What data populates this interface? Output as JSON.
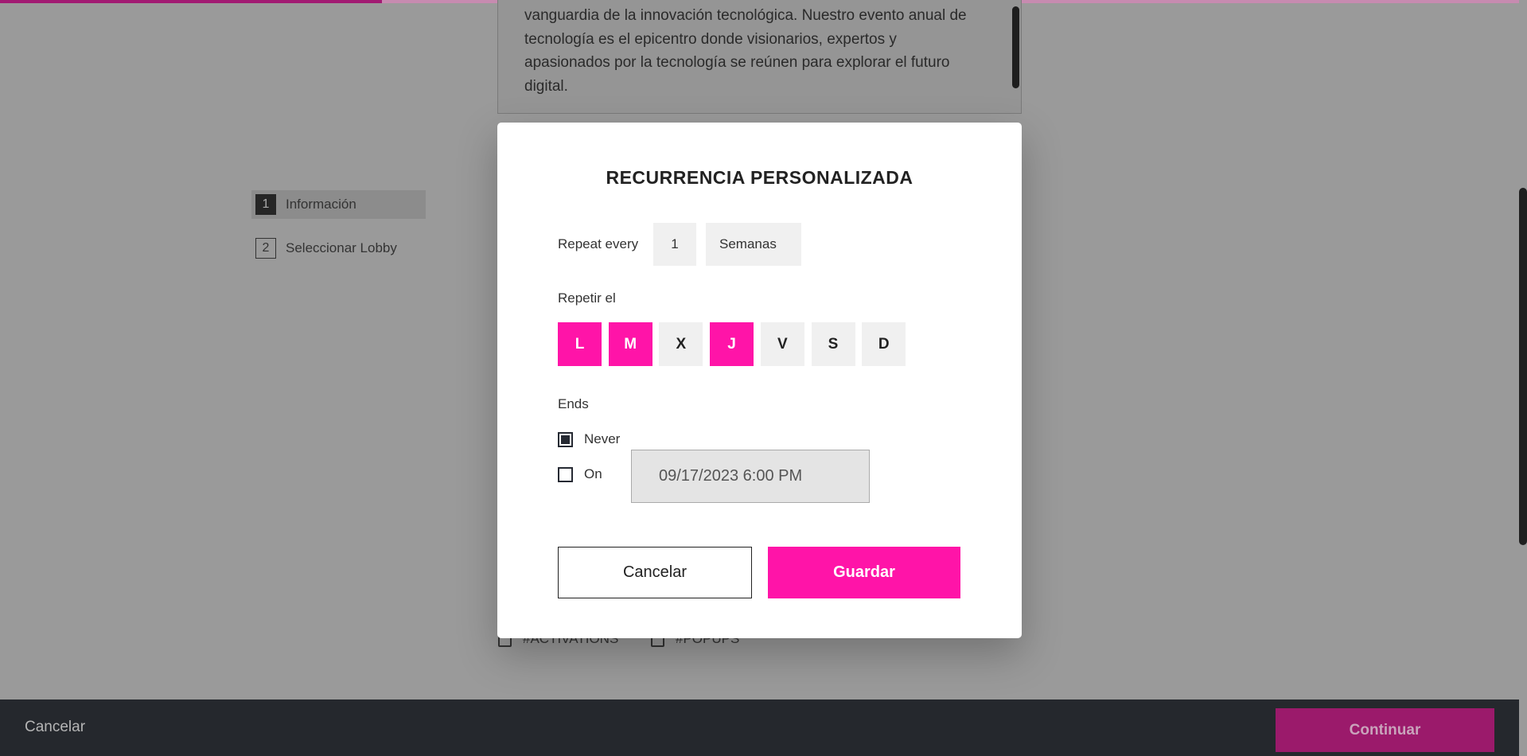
{
  "progress": {
    "percent": 25
  },
  "description_text": "vanguardia de la innovación tecnológica. Nuestro evento anual de tecnología es el epicentro donde visionarios, expertos y apasionados por la tecnología se reúnen para explorar el futuro digital.",
  "steps": [
    {
      "number": "1",
      "label": "Información",
      "active": true
    },
    {
      "number": "2",
      "label": "Seleccionar Lobby",
      "active": false
    }
  ],
  "tags": [
    "#ACTIVATIONS",
    "#POPUPS"
  ],
  "modal": {
    "title": "RECURRENCIA PERSONALIZADA",
    "repeat_every_label": "Repeat every",
    "repeat_every_value": "1",
    "repeat_unit": "Semanas",
    "repeat_on_label": "Repetir el",
    "days": [
      {
        "label": "L",
        "selected": true
      },
      {
        "label": "M",
        "selected": true
      },
      {
        "label": "X",
        "selected": false
      },
      {
        "label": "J",
        "selected": true
      },
      {
        "label": "V",
        "selected": false
      },
      {
        "label": "S",
        "selected": false
      },
      {
        "label": "D",
        "selected": false
      }
    ],
    "ends_label": "Ends",
    "never_label": "Never",
    "never_checked": true,
    "on_label": "On",
    "on_checked": false,
    "end_date": "09/17/2023 6:00 PM",
    "cancel_label": "Cancelar",
    "save_label": "Guardar"
  },
  "footer": {
    "cancel_label": "Cancelar",
    "continue_label": "Continuar"
  },
  "colors": {
    "accent": "#ff14a8",
    "footer_bg": "#25282d",
    "continue_bg": "#9b1a6b"
  }
}
